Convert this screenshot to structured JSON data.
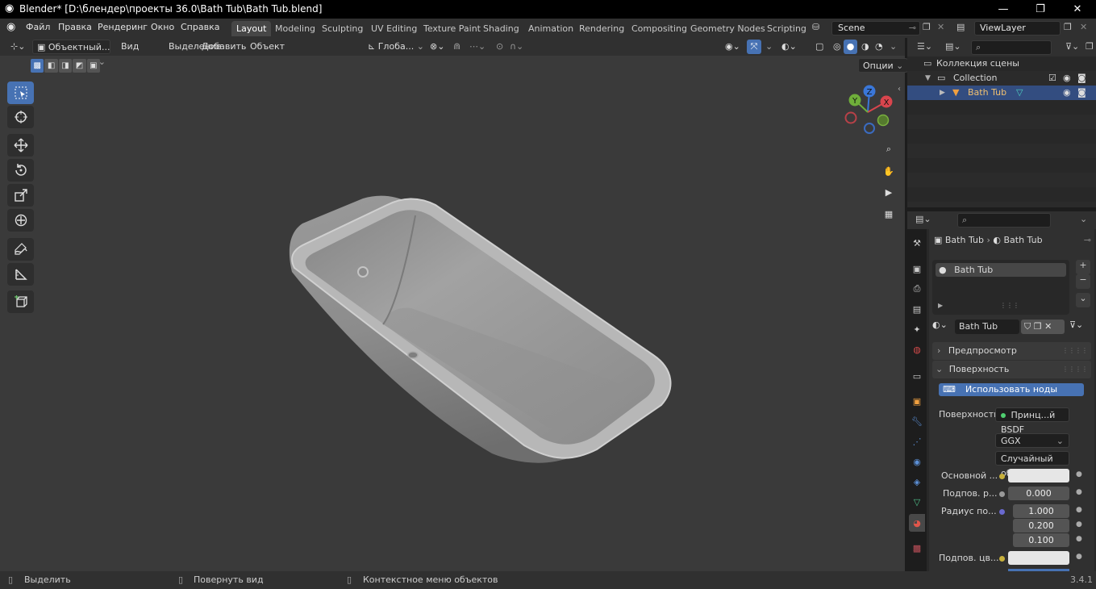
{
  "window": {
    "title": "Blender* [D:\\блендер\\проекты 36.0\\Bath Tub\\Bath Tub.blend]",
    "minimize": "—",
    "maximize": "❐",
    "close": "✕"
  },
  "menu": [
    "Файл",
    "Правка",
    "Рендеринг",
    "Окно",
    "Справка"
  ],
  "workspaces": [
    "Layout",
    "Modeling",
    "Sculpting",
    "UV Editing",
    "Texture Paint",
    "Shading",
    "Animation",
    "Rendering",
    "Compositing",
    "Geometry Nodes",
    "Scripting"
  ],
  "active_workspace": "Layout",
  "scene": {
    "name": "Scene",
    "view_layer": "ViewLayer"
  },
  "viewport": {
    "mode": "Объектный...",
    "menus": [
      "Вид",
      "Выделение",
      "Добавить",
      "Объект"
    ],
    "transform_orientation": "Глоба...",
    "options": "Опции",
    "gizmo_axes": {
      "x": "X",
      "y": "Y",
      "z": "Z"
    }
  },
  "outliner": {
    "root": "Коллекция сцены",
    "collection": "Collection",
    "object": "Bath Tub"
  },
  "properties": {
    "breadcrumb_object": "Bath Tub",
    "breadcrumb_material": "Bath Tub",
    "slot": "Bath Tub",
    "material_name": "Bath Tub",
    "preview": "Предпросмотр",
    "surface_panel": "Поверхность",
    "use_nodes": "Использовать ноды",
    "surface_label": "Поверхность",
    "surface_shader": "Принц...й BSDF",
    "distribution": "GGX",
    "subsurface_method": "Случайный об...",
    "base_color_label": "Основной ...",
    "subsurface_label": "Подпов. р...",
    "subsurface_value": "0.000",
    "radius_label": "Радиус по...",
    "radius": [
      "1.000",
      "0.200",
      "0.100"
    ],
    "subsurface_color_label": "Подпов. цв..."
  },
  "status": {
    "select": "Выделить",
    "rotate": "Повернуть вид",
    "context": "Контекстное меню объектов",
    "version": "3.4.1"
  }
}
